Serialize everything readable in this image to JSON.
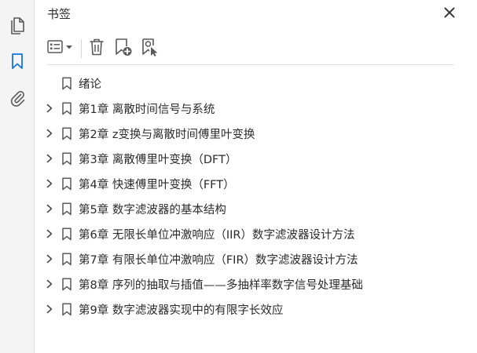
{
  "panel": {
    "title": "书签"
  },
  "rail": {
    "items": [
      {
        "icon": "pages-icon",
        "active": false
      },
      {
        "icon": "bookmark-icon",
        "active": true
      },
      {
        "icon": "attachment-icon",
        "active": false
      }
    ]
  },
  "toolbar": {
    "buttons": [
      {
        "icon": "bookmark-options-icon"
      },
      {
        "icon": "delete-icon"
      },
      {
        "icon": "add-bookmark-icon"
      },
      {
        "icon": "find-bookmark-icon"
      }
    ]
  },
  "bookmarks": [
    {
      "label": "绪论",
      "expandable": false
    },
    {
      "label": "第1章  离散时间信号与系统",
      "expandable": true
    },
    {
      "label": "第2章  z变换与离散时间傅里叶变换",
      "expandable": true
    },
    {
      "label": "第3章  离散傅里叶变换（DFT）",
      "expandable": true
    },
    {
      "label": "第4章  快速傅里叶变换（FFT）",
      "expandable": true
    },
    {
      "label": "第5章  数字滤波器的基本结构",
      "expandable": true
    },
    {
      "label": "第6章  无限长单位冲激响应（IIR）数字滤波器设计方法",
      "expandable": true
    },
    {
      "label": "第7章  有限长单位冲激响应（FIR）数字滤波器设计方法",
      "expandable": true
    },
    {
      "label": "第8章  序列的抽取与插值——多抽样率数字信号处理基础",
      "expandable": true
    },
    {
      "label": "第9章  数字滤波器实现中的有限字长效应",
      "expandable": true
    }
  ],
  "colors": {
    "accent": "#1473e6",
    "icon": "#5a5a5a"
  }
}
